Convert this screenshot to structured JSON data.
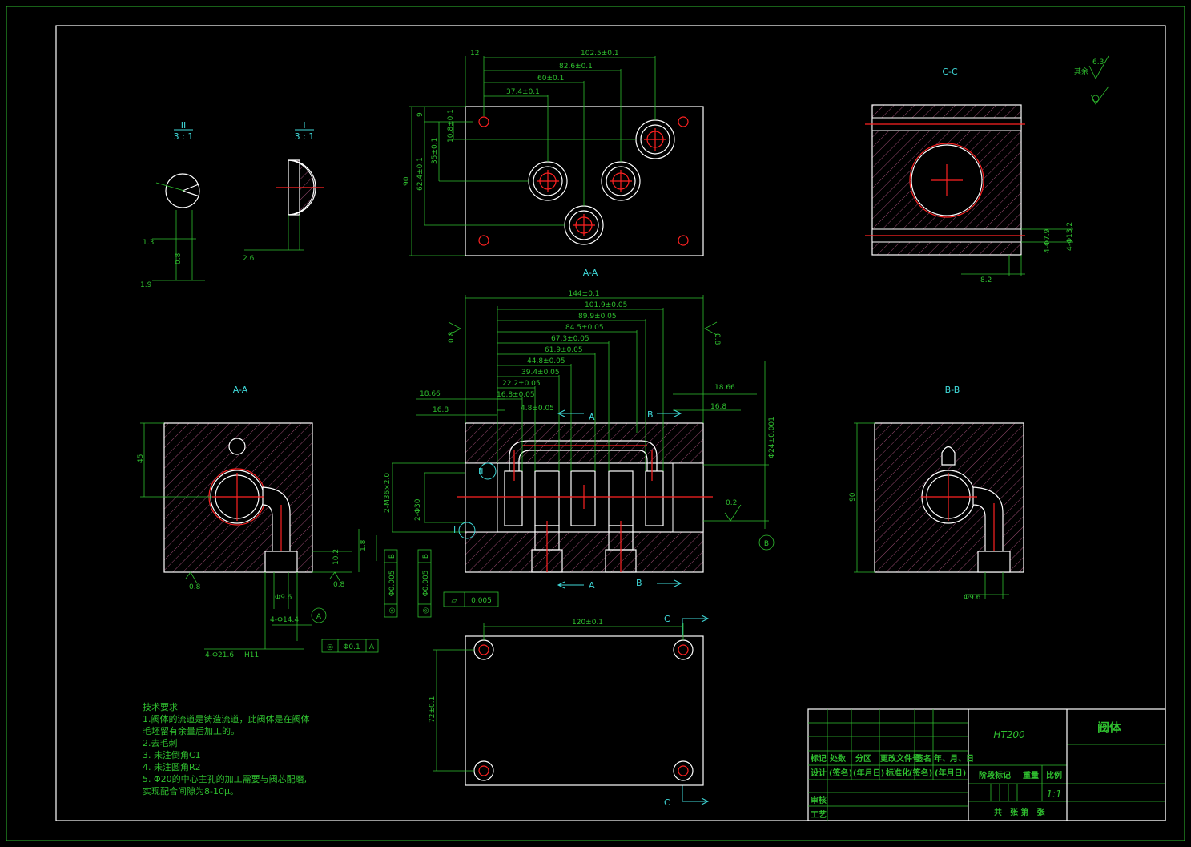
{
  "views": {
    "top_section": "A-A",
    "left_section": "A-A",
    "right_section": "B-B",
    "cc_section": "C-C",
    "detail_ii": {
      "label": "II",
      "scale": "3 : 1"
    },
    "detail_i": {
      "label": "I",
      "scale": "3 : 1"
    }
  },
  "dimensions": {
    "top": [
      "12",
      "102.5±0.1",
      "82.6±0.1",
      "60±0.1",
      "37.4±0.1",
      "9",
      "10.8±0.1",
      "35±0.1",
      "62.4±0.1",
      "90"
    ],
    "main": [
      "144±0.1",
      "101.9±0.05",
      "89.9±0.05",
      "84.5±0.05",
      "67.3±0.05",
      "61.9±0.05",
      "44.8±0.05",
      "39.4±0.05",
      "22.2±0.05",
      "16.8±0.05",
      "4.8±0.05",
      "18.66",
      "16.8",
      "18.66",
      "16.8",
      "2-M36×2.0",
      "2-Φ30",
      "1.8",
      "0.8",
      "0.8",
      "0.2",
      "Φ24±0.001"
    ],
    "left": [
      "45",
      "0.8",
      "0.8",
      "Φ9.6",
      "4-Φ14.4",
      "4-Φ21.6",
      "H11",
      "10.2"
    ],
    "right": [
      "90",
      "Φ9.6"
    ],
    "cc": [
      "4-Φ7.9",
      "4-Φ13.2",
      "8.2"
    ],
    "bottom": [
      "120±0.1",
      "72±0.1"
    ],
    "detail": [
      "1.3",
      "1.9",
      "2.6",
      "0.8"
    ]
  },
  "tolerance_frames": {
    "f1": {
      "symbol": "◎",
      "value": "Φ0.005",
      "datum": "B"
    },
    "f2": {
      "symbol": "◎",
      "value": "Φ0.005",
      "datum": "B"
    },
    "f3": {
      "symbol": "▱",
      "value": "0.005",
      "datum": ""
    },
    "f4": {
      "symbol": "◎",
      "value": "Φ0.1",
      "datum": "A"
    }
  },
  "datums": {
    "a": "A",
    "b": "B"
  },
  "section_markers": {
    "a": "A",
    "b": "B",
    "c": "C"
  },
  "surface": {
    "value": "6.3",
    "rest_label": "其余"
  },
  "tech_requirements": {
    "title": "技术要求",
    "lines": [
      "1.阀体的流道是铸造流道，此阀体是在阀体",
      "毛坯留有余量后加工的。",
      "2.去毛刺",
      "3. 未注倒角C1",
      "4. 未注圆角R2",
      "5. Φ20的中心主孔的加工需要与阀芯配磨,",
      "实现配合间隙为8-10μ。"
    ]
  },
  "title_block": {
    "material": "HT200",
    "part_name": "阀体",
    "headers": [
      "标记",
      "处数",
      "分区",
      "更改文件号",
      "签名",
      "年、月、日"
    ],
    "row_design": [
      "设计",
      "(签名)",
      "(年月日)",
      "标准化",
      "(签名)",
      "(年月日)"
    ],
    "stage_mark": "阶段标记",
    "weight": "重量",
    "scale_label": "比例",
    "scale": "1:1",
    "review": "审核",
    "process": "工艺",
    "sheets": "共　张 第　张"
  },
  "colors": {
    "background": "#000000",
    "line": "#ffffff",
    "dimension": "#2fbf2f",
    "center": "#ff2222",
    "label": "#3fd8d8"
  }
}
